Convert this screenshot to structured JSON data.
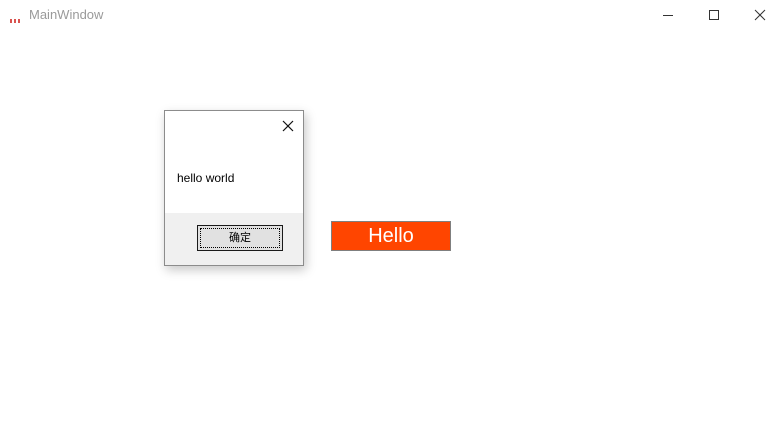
{
  "window": {
    "title": "MainWindow",
    "controls": {
      "minimize_icon": "minimize-icon",
      "maximize_icon": "maximize-icon",
      "close_icon": "close-icon"
    }
  },
  "dialog": {
    "message": "hello world",
    "ok_label": "确定",
    "close_icon": "close-icon"
  },
  "main": {
    "hello_label": "Hello",
    "hello_bg_color": "#ff4500"
  }
}
